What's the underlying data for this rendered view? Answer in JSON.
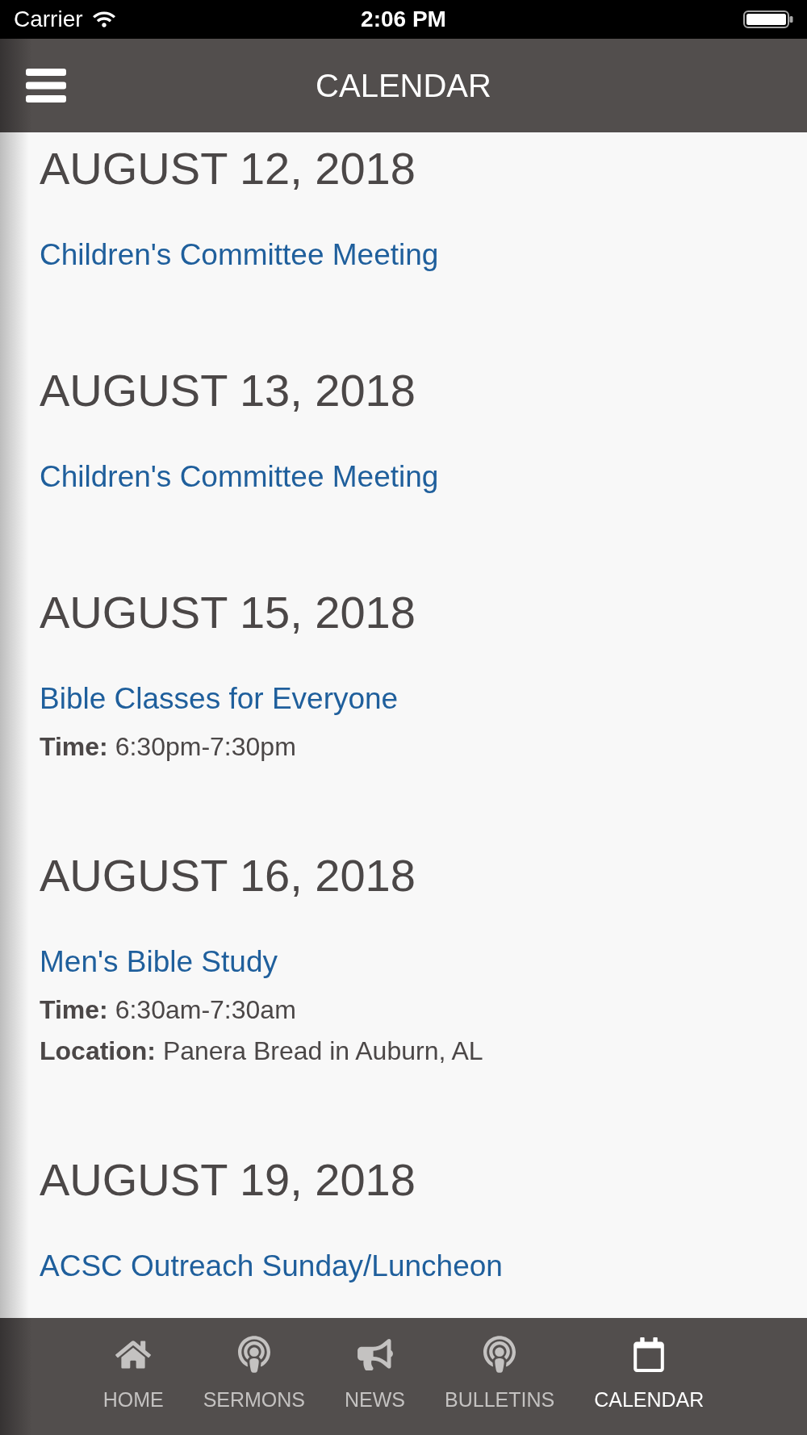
{
  "status_bar": {
    "carrier": "Carrier",
    "time": "2:06 PM"
  },
  "header": {
    "title": "CALENDAR"
  },
  "days": [
    {
      "date": "AUGUST 12, 2018",
      "events": [
        {
          "title": "Children's Committee Meeting"
        }
      ]
    },
    {
      "date": "AUGUST 13, 2018",
      "events": [
        {
          "title": "Children's Committee Meeting"
        }
      ]
    },
    {
      "date": "AUGUST 15, 2018",
      "events": [
        {
          "title": "Bible Classes for Everyone",
          "details": [
            {
              "label": "Time:",
              "value": "6:30pm-7:30pm"
            }
          ]
        }
      ]
    },
    {
      "date": "AUGUST 16, 2018",
      "events": [
        {
          "title": "Men's Bible Study",
          "details": [
            {
              "label": "Time:",
              "value": "6:30am-7:30am"
            },
            {
              "label": "Location:",
              "value": "Panera Bread in Auburn, AL"
            }
          ]
        }
      ]
    },
    {
      "date": "AUGUST 19, 2018",
      "events": [
        {
          "title": "ACSC Outreach Sunday/Luncheon"
        }
      ]
    }
  ],
  "tabs": [
    {
      "label": "HOME",
      "kind": "home",
      "selected": false
    },
    {
      "label": "SERMONS",
      "kind": "podcast",
      "selected": false
    },
    {
      "label": "NEWS",
      "kind": "megaphone",
      "selected": false
    },
    {
      "label": "BULLETINS",
      "kind": "podcast",
      "selected": false
    },
    {
      "label": "CALENDAR",
      "kind": "calendar",
      "selected": true
    }
  ]
}
